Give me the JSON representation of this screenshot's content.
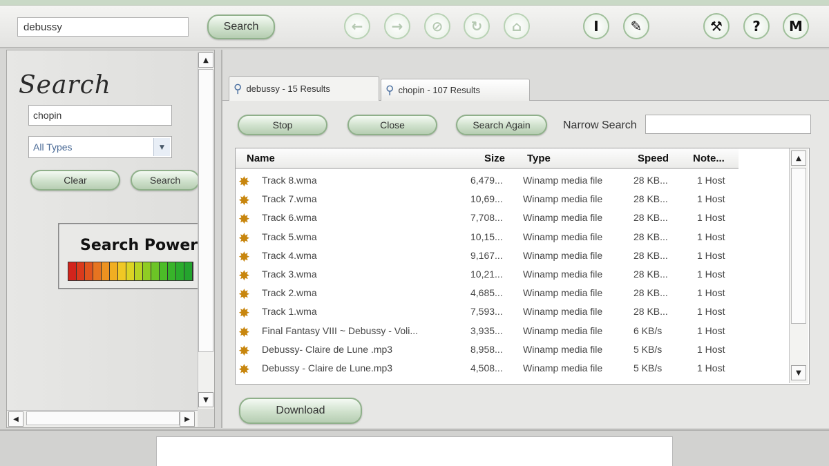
{
  "toolbar": {
    "search_value": "debussy",
    "search_button": "Search",
    "nav_icons": [
      "back-arrow-icon",
      "forward-arrow-icon",
      "stop-icon",
      "refresh-icon",
      "home-icon"
    ],
    "tool_icons": [
      "text-i-icon",
      "pen-icon",
      "wrench-icon",
      "help-icon",
      "logo-m-icon"
    ]
  },
  "left_panel": {
    "heading": "Search",
    "query": "chopin",
    "type_select": "All Types",
    "clear_label": "Clear",
    "search_label": "Search",
    "power_title": "Search Power",
    "power_level": 1.0
  },
  "tabs": [
    {
      "label": "debussy - 15 Results",
      "active": true
    },
    {
      "label": "chopin - 107 Results",
      "active": false
    }
  ],
  "results_toolbar": {
    "stop_label": "Stop",
    "close_label": "Close",
    "search_again_label": "Search Again",
    "narrow_label": "Narrow Search"
  },
  "results": {
    "columns": [
      "Name",
      "Size",
      "Type",
      "Speed",
      "Note..."
    ],
    "rows": [
      {
        "name": "Track 8.wma",
        "size": "6,479...",
        "type": "Winamp media file",
        "speed": "28 KB...",
        "note": "1 Host"
      },
      {
        "name": "Track 7.wma",
        "size": "10,69...",
        "type": "Winamp media file",
        "speed": "28 KB...",
        "note": "1 Host"
      },
      {
        "name": "Track 6.wma",
        "size": "7,708...",
        "type": "Winamp media file",
        "speed": "28 KB...",
        "note": "1 Host"
      },
      {
        "name": "Track 5.wma",
        "size": "10,15...",
        "type": "Winamp media file",
        "speed": "28 KB...",
        "note": "1 Host"
      },
      {
        "name": "Track 4.wma",
        "size": "9,167...",
        "type": "Winamp media file",
        "speed": "28 KB...",
        "note": "1 Host"
      },
      {
        "name": "Track 3.wma",
        "size": "10,21...",
        "type": "Winamp media file",
        "speed": "28 KB...",
        "note": "1 Host"
      },
      {
        "name": "Track 2.wma",
        "size": "4,685...",
        "type": "Winamp media file",
        "speed": "28 KB...",
        "note": "1 Host"
      },
      {
        "name": "Track 1.wma",
        "size": "7,593...",
        "type": "Winamp media file",
        "speed": "28 KB...",
        "note": "1 Host"
      },
      {
        "name": "Final Fantasy VIII ~ Debussy - Voli...",
        "size": "3,935...",
        "type": "Winamp media file",
        "speed": "6 KB/s",
        "note": "1 Host"
      },
      {
        "name": "Debussy- Claire de Lune .mp3",
        "size": "8,958...",
        "type": "Winamp media file",
        "speed": "5 KB/s",
        "note": "1 Host"
      },
      {
        "name": "Debussy - Claire de Lune.mp3",
        "size": "4,508...",
        "type": "Winamp media file",
        "speed": "5 KB/s",
        "note": "1 Host"
      }
    ]
  },
  "download_label": "Download"
}
